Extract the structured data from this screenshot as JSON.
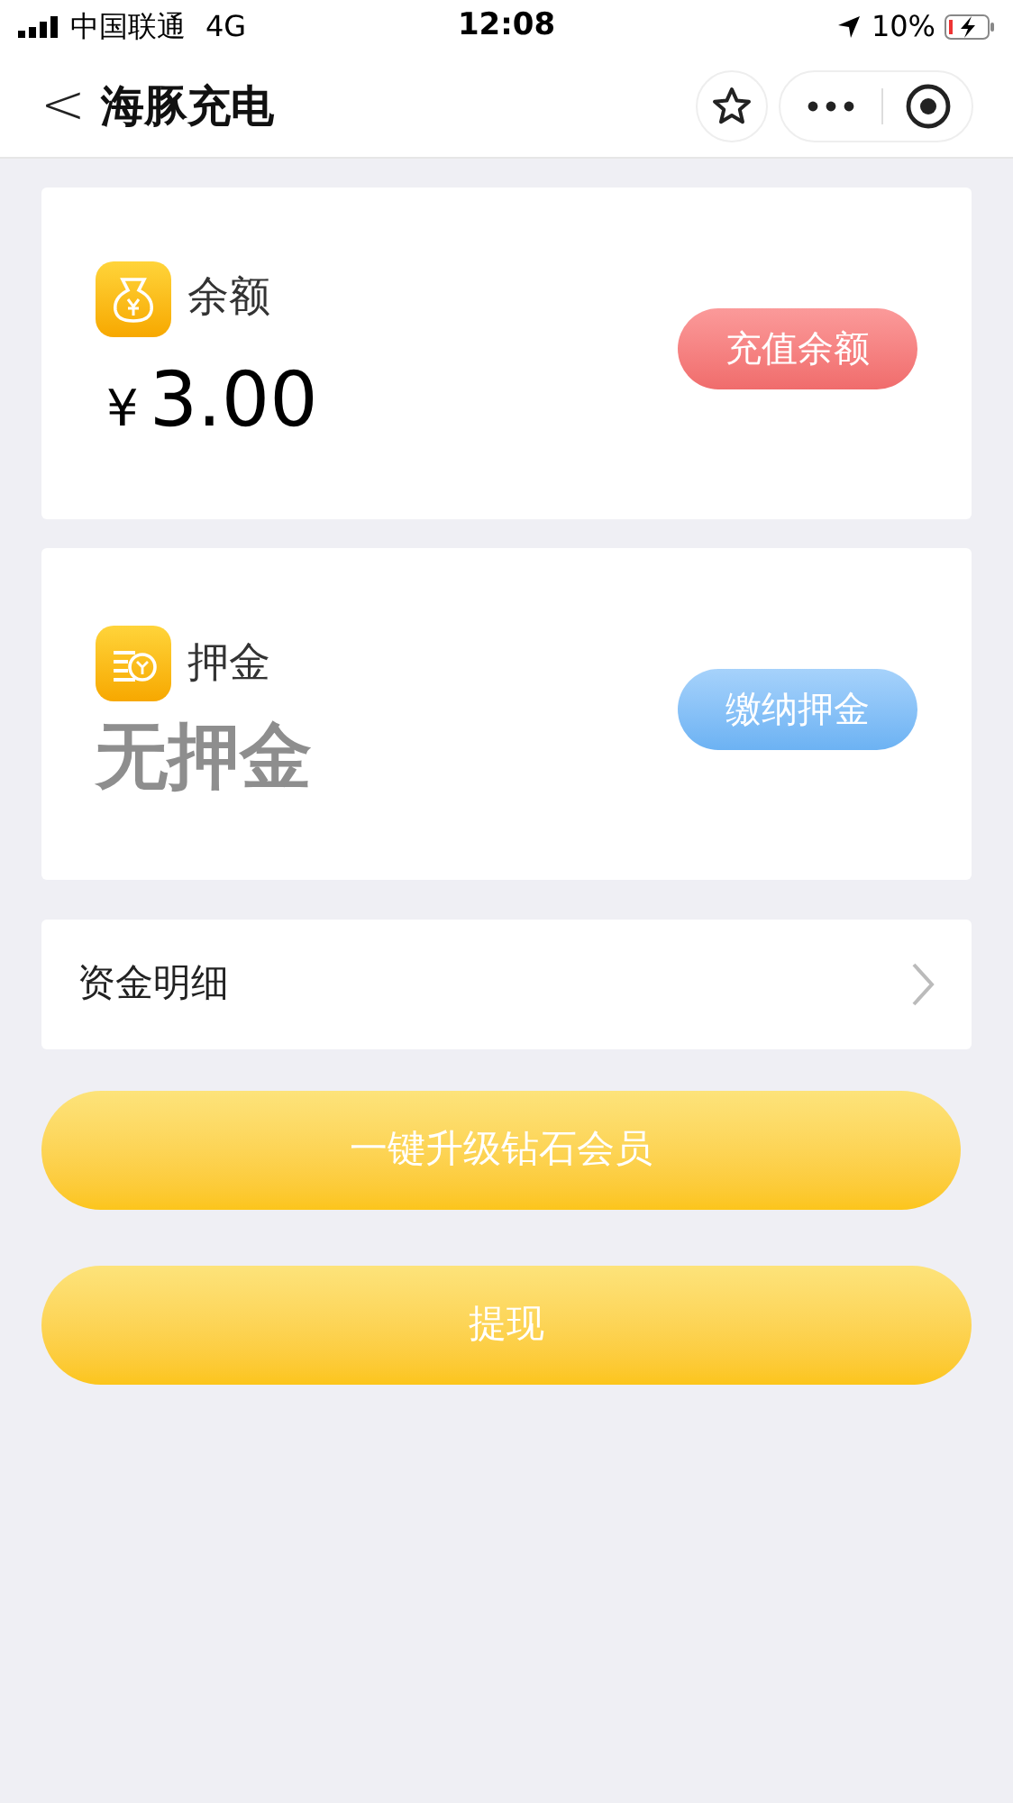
{
  "status_bar": {
    "carrier": "中国联通",
    "network": "4G",
    "time": "12:08",
    "battery": "10%"
  },
  "nav": {
    "back": "<",
    "title": "海豚充电"
  },
  "cards": [
    {
      "kind": "balance",
      "label": "余额",
      "currency": "¥",
      "amount": "3.00",
      "button": "充值余额"
    },
    {
      "kind": "deposit",
      "label": "押金",
      "amount": "无押金",
      "button": "缴纳押金"
    }
  ],
  "detail_row": {
    "label": "资金明细"
  },
  "actions": [
    {
      "label": "一键升级钻石会员",
      "kind": "narrow"
    },
    {
      "label": "提现",
      "kind": "wide"
    }
  ]
}
